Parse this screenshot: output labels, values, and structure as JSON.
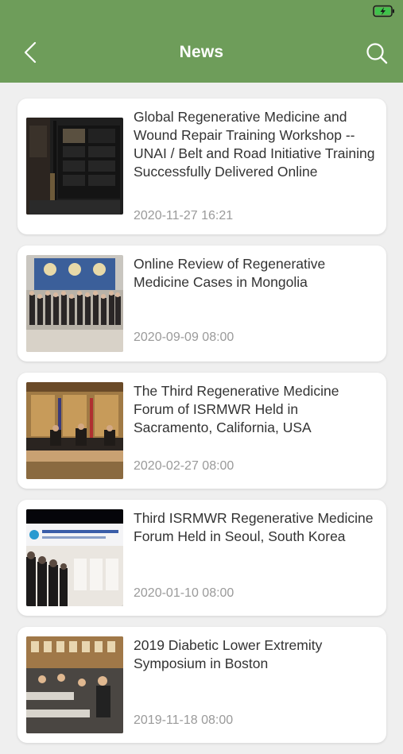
{
  "header": {
    "title": "News",
    "background": "#6e9d5a",
    "back_icon": "chevron-left-icon",
    "search_icon": "search-icon",
    "battery_icon": "battery-charging-icon"
  },
  "news": [
    {
      "title": "Global Regenerative Medicine and Wound Repair Training Workshop -- UNAI / Belt and Road Initiative Training Successfully Delivered Online",
      "date": "2020-11-27 16:21"
    },
    {
      "title": "Online Review of Regenerative Medicine Cases in Mongolia",
      "date": "2020-09-09 08:00"
    },
    {
      "title": "The Third Regenerative Medicine Forum of ISRMWR Held in Sacramento, California, USA",
      "date": "2020-02-27 08:00"
    },
    {
      "title": "Third ISRMWR Regenerative Medicine Forum Held in Seoul, South Korea",
      "date": "2020-01-10 08:00"
    },
    {
      "title": "2019 Diabetic Lower Extremity Symposium in Boston",
      "date": "2019-11-18 08:00"
    }
  ]
}
